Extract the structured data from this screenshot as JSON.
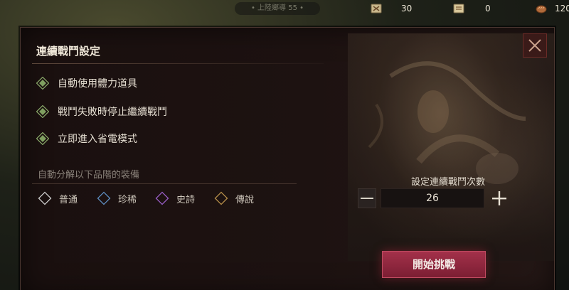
{
  "topbar": {
    "world_label": "• 上陸鄉導 55 •",
    "resources": [
      {
        "icon": "battle-ticket-icon",
        "value": "30"
      },
      {
        "icon": "scroll-ticket-icon",
        "value": "0"
      },
      {
        "icon": "bread-icon",
        "value": "120"
      }
    ]
  },
  "dialog": {
    "title": "連續戰鬥設定",
    "options": [
      {
        "label": "自動使用體力道具",
        "checked": true
      },
      {
        "label": "戰鬥失敗時停止繼續戰鬥",
        "checked": true
      },
      {
        "label": "立即進入省電模式",
        "checked": true
      }
    ],
    "grade_heading": "自動分解以下品階的裝備",
    "grades": [
      {
        "label": "普通",
        "color": "#cfcfcf",
        "checked": false
      },
      {
        "label": "珍稀",
        "color": "#5f8fc4",
        "checked": false
      },
      {
        "label": "史詩",
        "color": "#9a5fc8",
        "checked": false
      },
      {
        "label": "傳說",
        "color": "#b8904a",
        "checked": false
      }
    ],
    "count": {
      "label": "設定連續戰鬥次數",
      "value": "26"
    },
    "start_label": "開始挑戰"
  },
  "colors": {
    "accent_green": "#7fa060",
    "start_button": "#8e2640",
    "close_button": "#3a1a18"
  }
}
